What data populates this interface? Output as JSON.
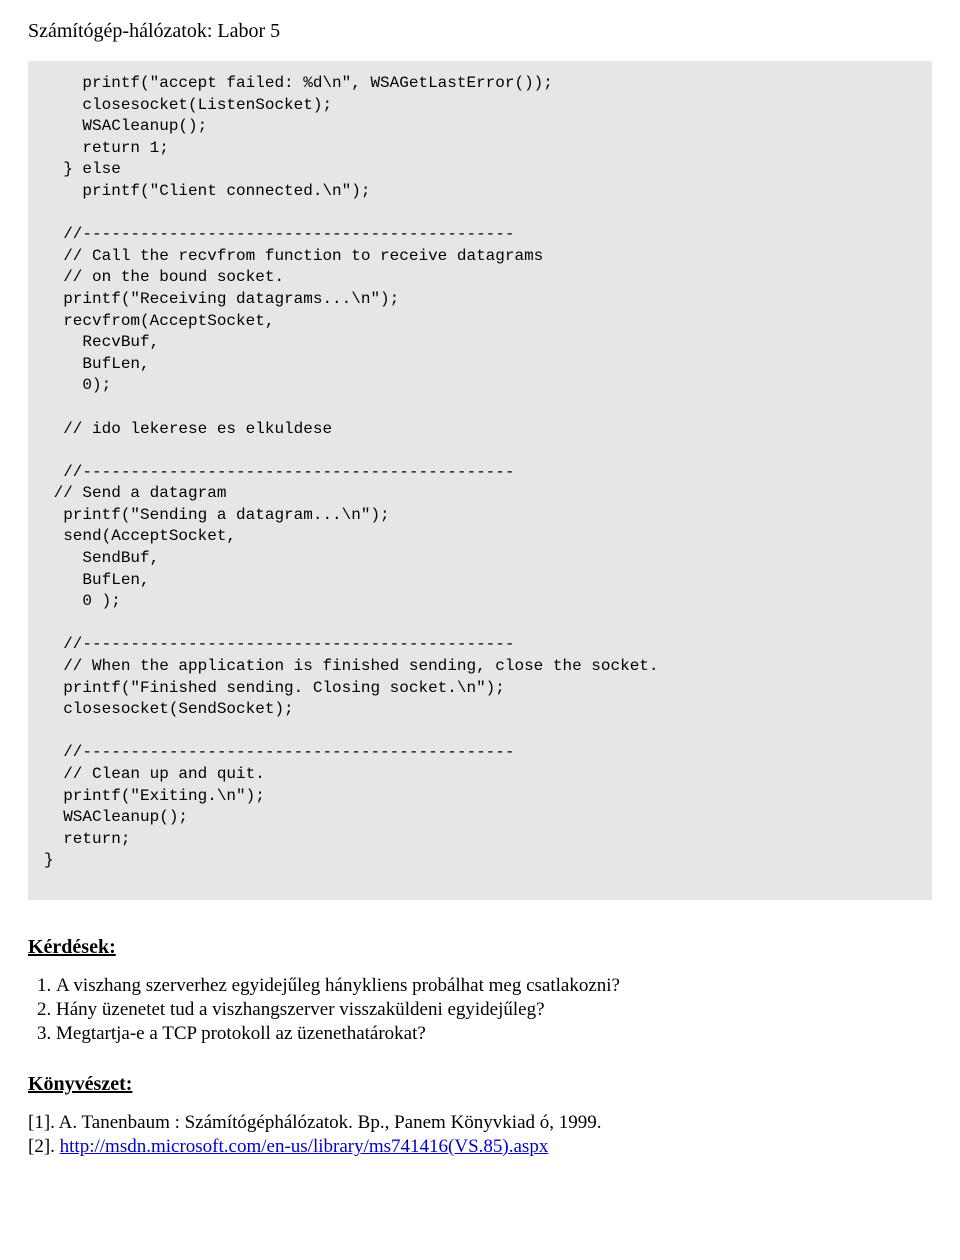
{
  "header": "Számítógép-hálózatok: Labor 5",
  "code": "    printf(\"accept failed: %d\\n\", WSAGetLastError());\n    closesocket(ListenSocket);\n    WSACleanup();\n    return 1;\n  } else\n    printf(\"Client connected.\\n\");\n\n  //---------------------------------------------\n  // Call the recvfrom function to receive datagrams\n  // on the bound socket.\n  printf(\"Receiving datagrams...\\n\");\n  recvfrom(AcceptSocket,\n    RecvBuf,\n    BufLen,\n    0);\n\n  // ido lekerese es elkuldese\n\n  //---------------------------------------------\n // Send a datagram\n  printf(\"Sending a datagram...\\n\");\n  send(AcceptSocket,\n    SendBuf,\n    BufLen,\n    0 );\n\n  //---------------------------------------------\n  // When the application is finished sending, close the socket.\n  printf(\"Finished sending. Closing socket.\\n\");\n  closesocket(SendSocket);\n\n  //---------------------------------------------\n  // Clean up and quit.\n  printf(\"Exiting.\\n\");\n  WSACleanup();\n  return;\n}",
  "questions_heading": "Kérdések:",
  "questions": [
    "A viszhang szerverhez egyidejűleg hánykliens probálhat meg csatlakozni?",
    "Hány üzenetet tud a viszhangszerver visszaküldeni egyidejűleg?",
    "Megtartja-e a TCP protokoll az üzenethatárokat?"
  ],
  "refs_heading": "Könyvészet:",
  "ref1": "[1]. A. Tanenbaum : Számítógéphálózatok. Bp., Panem Könyvkiad ó, 1999.",
  "ref2_prefix": "[2]. ",
  "ref2_link_text": "http://msdn.microsoft.com/en-us/library/ms741416(VS.85).aspx",
  "ref2_link_href": "http://msdn.microsoft.com/en-us/library/ms741416(VS.85).aspx"
}
